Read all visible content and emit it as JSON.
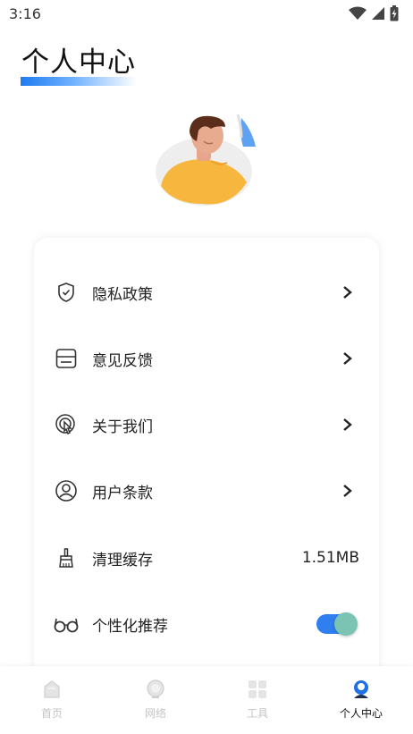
{
  "status_bar": {
    "time": "3:16",
    "icons": [
      "wifi-icon",
      "signal-icon",
      "battery-charging-icon"
    ]
  },
  "page": {
    "title": "个人中心"
  },
  "avatar": {
    "icon": "user-avatar-illustration"
  },
  "menu": {
    "items": [
      {
        "label": "隐私政策",
        "icon": "shield-check-icon",
        "trailing": "chevron"
      },
      {
        "label": "意见反馈",
        "icon": "feedback-icon",
        "trailing": "chevron"
      },
      {
        "label": "关于我们",
        "icon": "touch-icon",
        "trailing": "chevron"
      },
      {
        "label": "用户条款",
        "icon": "user-circle-icon",
        "trailing": "chevron"
      },
      {
        "label": "清理缓存",
        "icon": "broom-icon",
        "value": "1.51MB"
      },
      {
        "label": "个性化推荐",
        "icon": "glasses-icon",
        "toggle": true
      }
    ]
  },
  "bottom_nav": {
    "tabs": [
      {
        "label": "首页",
        "icon": "home-icon",
        "active": false
      },
      {
        "label": "网络",
        "icon": "globe-icon",
        "active": false
      },
      {
        "label": "工具",
        "icon": "grid-icon",
        "active": false
      },
      {
        "label": "个人中心",
        "icon": "profile-icon",
        "active": true
      }
    ]
  },
  "colors": {
    "accent": "#2f7ff0",
    "toggle_knob": "#7bc4b4",
    "inactive": "#c4c4c4"
  }
}
